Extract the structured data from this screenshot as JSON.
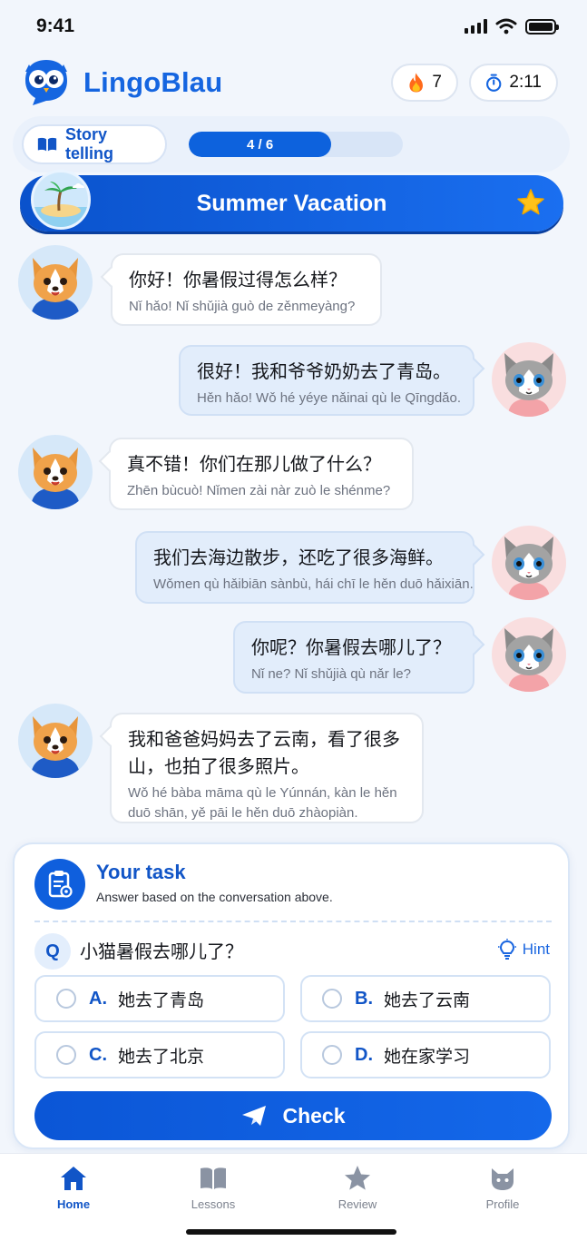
{
  "status_bar": {
    "time": "9:41"
  },
  "app": {
    "name": "LingoBlau"
  },
  "header": {
    "streak_count": "7",
    "timer": "2:11"
  },
  "lesson": {
    "mode_label": "Story telling",
    "progress_text": "4 / 6",
    "progress_fraction": 0.667,
    "title": "Summer Vacation"
  },
  "messages": [
    {
      "speaker": "dog",
      "side": "left",
      "chinese": "你好！你暑假过得怎么样？",
      "pinyin": "Nǐ hǎo! Nǐ shǔjià guò de zěnmeyàng?"
    },
    {
      "speaker": "cat",
      "side": "right",
      "chinese": "很好！我和爷爷奶奶去了青岛。",
      "pinyin": "Hěn hǎo! Wǒ hé yéye nǎinai qù le Qīngdǎo."
    },
    {
      "speaker": "dog",
      "side": "left",
      "chinese": "真不错！你们在那儿做了什么？",
      "pinyin": "Zhēn bùcuò! Nǐmen zài nàr zuò le shénme?"
    },
    {
      "speaker": "cat",
      "side": "right",
      "chinese": "我们去海边散步，还吃了很多海鲜。",
      "pinyin": "Wǒmen qù hǎibiān sànbù, hái chī le hěn duō hǎixiān."
    },
    {
      "speaker": "cat",
      "side": "right",
      "chinese": "你呢？你暑假去哪儿了？",
      "pinyin": "Nǐ ne? Nǐ shǔjià qù nǎr le?"
    },
    {
      "speaker": "dog",
      "side": "left",
      "chinese": "我和爸爸妈妈去了云南，看了很多山，也拍了很多照片。",
      "pinyin": "Wǒ hé bàba māma qù le Yúnnán, kàn le hěn duō shān, yě pāi le hěn duō zhàopiàn."
    }
  ],
  "task": {
    "title": "Your task",
    "subtitle": "Answer based on the conversation above.",
    "q_label": "Q",
    "question": "小猫暑假去哪儿了？",
    "hint_label": "Hint",
    "options": [
      {
        "letter": "A.",
        "text": "她去了青岛"
      },
      {
        "letter": "B.",
        "text": "她去了云南"
      },
      {
        "letter": "C.",
        "text": "她去了北京"
      },
      {
        "letter": "D.",
        "text": "她在家学习"
      }
    ],
    "check_label": "Check"
  },
  "tabs": [
    {
      "label": "Home",
      "icon": "home-icon",
      "active": true
    },
    {
      "label": "Lessons",
      "icon": "book-icon",
      "active": false
    },
    {
      "label": "Review",
      "icon": "star-icon",
      "active": false
    },
    {
      "label": "Profile",
      "icon": "cat-face-icon",
      "active": false
    }
  ],
  "colors": {
    "brand_blue": "#1565e0",
    "banner_blue": "#0a52cc",
    "bubble_right": "#e2edfb",
    "star_yellow": "#ffc21a",
    "fire_orange": "#ff6a1a"
  }
}
